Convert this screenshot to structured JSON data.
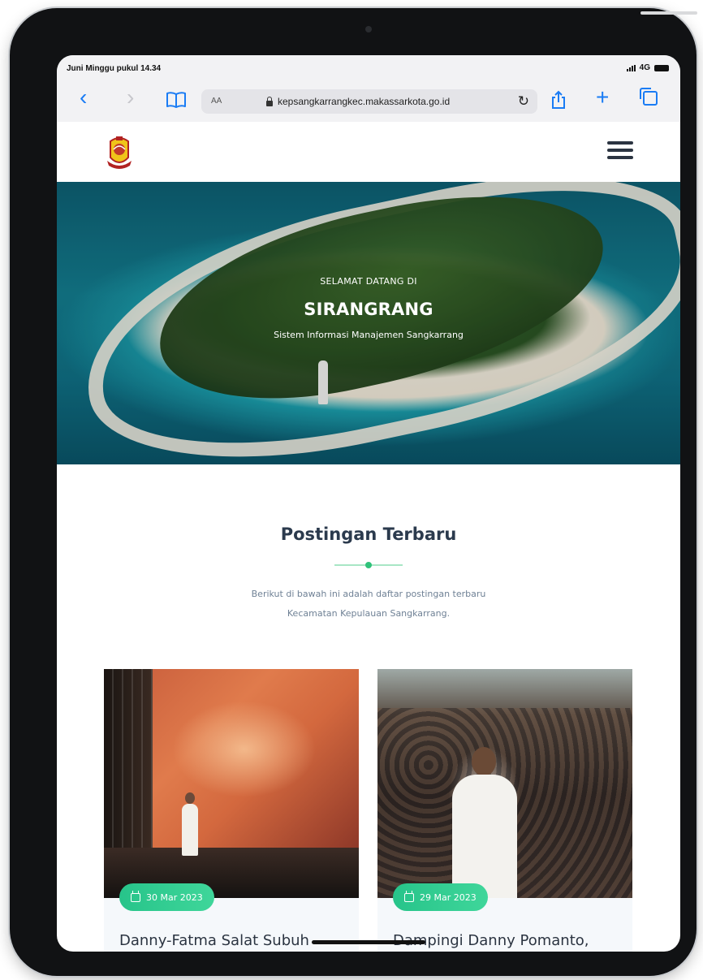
{
  "status_bar": {
    "time": "Juni Minggu pukul 14.34",
    "network": "4G"
  },
  "browser": {
    "text_size_label": "AA",
    "url": "kepsangkarrangkec.makassarkota.go.id",
    "icons": [
      "back-icon",
      "forward-icon",
      "bookmarks-icon",
      "lock-icon",
      "reload-icon",
      "share-icon",
      "new-tab-icon",
      "tabs-icon"
    ]
  },
  "site": {
    "logo_icon": "city-emblem-icon",
    "menu_icon": "hamburger-menu-icon"
  },
  "hero": {
    "kicker": "SELAMAT DATANG DI",
    "title": "SIRANGRANG",
    "subtitle": "Sistem Informasi Manajemen Sangkarrang"
  },
  "posts_section": {
    "title": "Postingan Terbaru",
    "description_line1": "Berikut di bawah ini adalah daftar postingan terbaru",
    "description_line2": "Kecamatan Kepulauan Sangkarrang.",
    "accent_color": "#2fc27a"
  },
  "posts": [
    {
      "date": "30 Mar 2023",
      "title": "Danny-Fatma Salat Subuh"
    },
    {
      "date": "29 Mar 2023",
      "title": "Dampingi Danny Pomanto,"
    }
  ]
}
